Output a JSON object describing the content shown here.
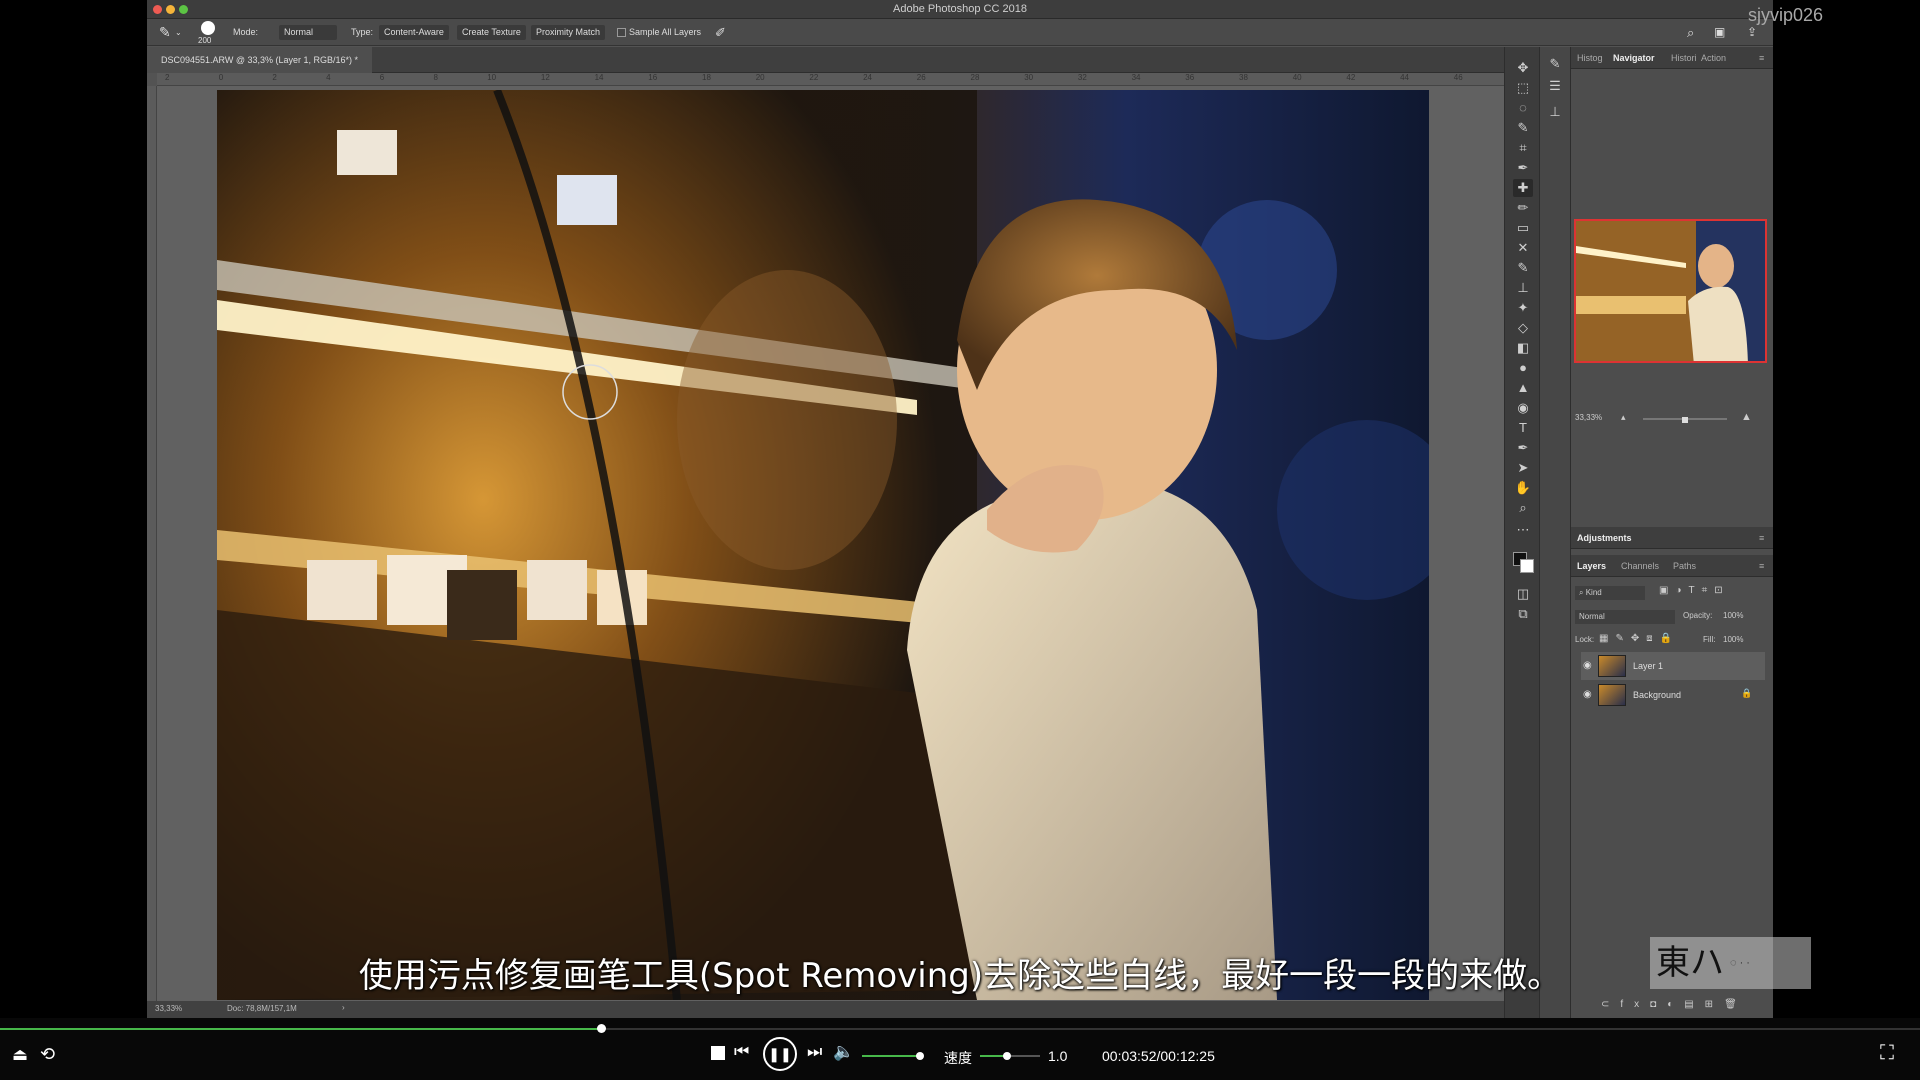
{
  "app": {
    "title": "Adobe Photoshop CC 2018",
    "watermark": "sjyvip026"
  },
  "options_bar": {
    "brush_size": "200",
    "mode_label": "Mode:",
    "mode_value": "Normal",
    "type_label": "Type:",
    "type_content_aware": "Content-Aware",
    "type_create_texture": "Create Texture",
    "type_proximity_match": "Proximity Match",
    "sample_all_layers": "Sample All Layers"
  },
  "document": {
    "tab_title": "DSC094551.ARW @ 33,3% (Layer 1, RGB/16*) *",
    "ruler_ticks": [
      "2",
      "0",
      "2",
      "4",
      "6",
      "8",
      "10",
      "12",
      "14",
      "16",
      "18",
      "20",
      "22",
      "24",
      "26",
      "28",
      "30",
      "32",
      "34",
      "36",
      "38",
      "40",
      "42",
      "44",
      "46"
    ],
    "zoom": "33,33%",
    "doc_size": "Doc: 78,8M/157,1M"
  },
  "panels": {
    "top_tabs": [
      "Histog",
      "Navigator",
      "Histori",
      "Action"
    ],
    "navigator_zoom": "33,33%",
    "navigator_zoom_fraction": 0.5,
    "adjustments_title": "Adjustments",
    "layers_tabs": [
      "Layers",
      "Channels",
      "Paths"
    ],
    "kind_filter": "Kind",
    "blend_mode": "Normal",
    "opacity_label": "Opacity:",
    "opacity_value": "100%",
    "lock_label": "Lock:",
    "fill_label": "Fill:",
    "fill_value": "100%",
    "layers": [
      {
        "name": "Layer 1",
        "selected": true
      },
      {
        "name": "Background",
        "locked": true
      }
    ]
  },
  "subtitle": "使用污点修复画笔工具(Spot Removing)去除这些白线，最好一段一段的来做。",
  "logo": {
    "text": "東ハ"
  },
  "player": {
    "progress": 0.313,
    "speed_label": "速度",
    "speed_value": "1.0",
    "speed_fraction": 0.45,
    "volume_fraction": 1.0,
    "time": "00:03:52/00:12:25"
  },
  "colors": {
    "accent": "#47b84a",
    "ps_bg": "#535353",
    "nav_frame": "#dd3333"
  }
}
